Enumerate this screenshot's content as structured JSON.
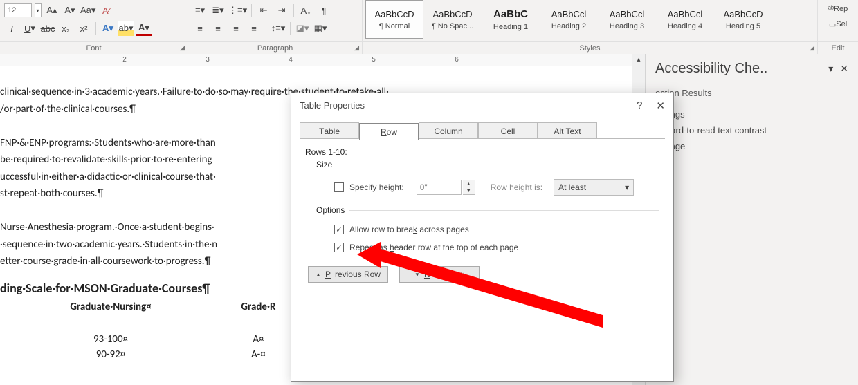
{
  "ribbon": {
    "font_size": "12",
    "font_group_label": "Font",
    "para_group_label": "Paragraph",
    "styles_group_label": "Styles",
    "edit_group_label": "Edit",
    "styles": [
      {
        "preview": "AaBbCcD",
        "name": "¶ Normal"
      },
      {
        "preview": "AaBbCcD",
        "name": "¶ No Spac..."
      },
      {
        "preview": "AaBbC",
        "name": "Heading 1"
      },
      {
        "preview": "AaBbCcl",
        "name": "Heading 2"
      },
      {
        "preview": "AaBbCcl",
        "name": "Heading 3"
      },
      {
        "preview": "AaBbCcl",
        "name": "Heading 4"
      },
      {
        "preview": "AaBbCcD",
        "name": "Heading 5"
      }
    ],
    "edit_items": [
      "Rep",
      "Sel"
    ]
  },
  "ruler_marks": [
    "",
    "",
    "2",
    "",
    "3",
    "",
    "4",
    "",
    "5",
    "",
    "6"
  ],
  "document": {
    "p1": "clinical·sequence·in·3·academic·years.·Failure·to·do·so·may·require·the·student·to·retake·all·",
    "p2": "/or·part·of·the·clinical·courses.¶",
    "p3": "FNP·&·ENP·programs:·Students·who·are·more·than",
    "p4": "be·required·to·revalidate·skills·prior·to·re-entering",
    "p5": "uccessful·in·either·a·didactic·or·clinical·course·that·",
    "p6": "st·repeat·both·courses.¶",
    "p7": "Nurse·Anesthesia·program.·Once·a·student·begins·",
    "p8": "·sequence·in·two·academic·years.·Students·in·the·n",
    "p9": "etter·course·grade·in·all·coursework·to·progress.¶",
    "h3": "ding·Scale·for·MSON·Graduate·Courses¶",
    "th1": "Graduate·Nursing¤",
    "th2": "Grade·R",
    "r1c1": "93-100¤",
    "r1c2": "A¤",
    "r2c1": "90-92¤",
    "r2c2": "A-¤"
  },
  "dialog": {
    "title": "Table Properties",
    "tabs": [
      "Table",
      "Row",
      "Column",
      "Cell",
      "Alt Text"
    ],
    "active_tab": 1,
    "rows_label": "Rows 1-10:",
    "size_legend": "Size",
    "specify_height_label": "Specify height:",
    "specify_height_checked": false,
    "height_value": "0\"",
    "row_height_is_label": "Row height is:",
    "row_height_mode": "At least",
    "options_legend": "Options",
    "opt_break": "Allow row to break across pages",
    "opt_break_checked": true,
    "opt_header": "Repeat as header row at the top of each page",
    "opt_header_checked": true,
    "prev_btn": "Previous Row",
    "next_btn": "Next Row"
  },
  "pane": {
    "title": "Accessibility Che..",
    "section_results": "ection Results",
    "warnings_label": "arnings",
    "item1": "Hard-to-read text contrast",
    "item2": "Page"
  }
}
